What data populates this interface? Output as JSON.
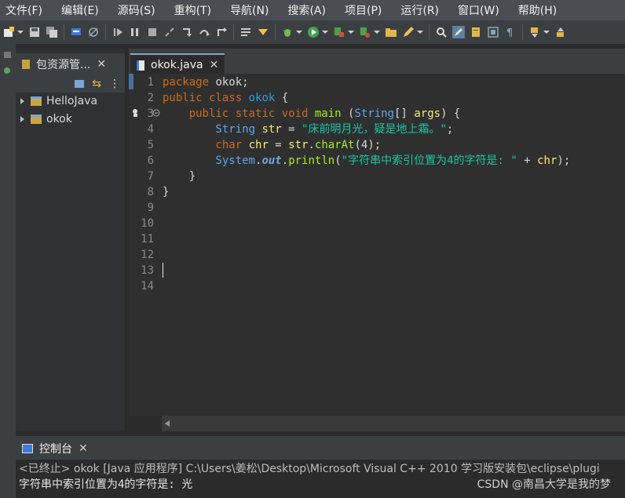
{
  "menu": [
    "文件(F)",
    "编辑(E)",
    "源码(S)",
    "重构(T)",
    "导航(N)",
    "搜索(A)",
    "项目(P)",
    "运行(R)",
    "窗口(W)",
    "帮助(H)"
  ],
  "toolbar_icons": [
    "new-icon",
    "save-icon",
    "save-all-icon",
    "open-type-icon",
    "skip-breakpoints-icon",
    "resume-icon",
    "suspend-icon",
    "terminate-icon",
    "disconnect-icon",
    "step-into-icon",
    "step-over-icon",
    "step-return-icon",
    "use-step-filters-icon",
    "debug-icon",
    "run-icon",
    "coverage-icon",
    "external-tools-icon",
    "open-folder-icon",
    "pencil-icon",
    "search-icon",
    "highlight-icon",
    "annotation-icon",
    "show-whitespace-icon",
    "pilcrow-icon",
    "next-annotation-icon"
  ],
  "explorer": {
    "title": "包资源管...",
    "projects": [
      {
        "name": "HelloJava"
      },
      {
        "name": "okok"
      }
    ]
  },
  "editor": {
    "tab_title": "okok.java",
    "line_numbers": [
      "1",
      "2",
      "3",
      "4",
      "5",
      "6",
      "7",
      "8",
      "9",
      "10",
      "11",
      "12",
      "13",
      "14"
    ],
    "lines": [
      {
        "t1": "package",
        "t2": " okok;"
      },
      {
        "t1": "public",
        "t2": " class ",
        "t3": "okok",
        "t4": " {"
      },
      {
        "t1": "    public",
        "t2": " static ",
        "t3": "void",
        "t4": " main",
        "t5": " (",
        "t6": "String",
        "t7": "[] ",
        "t8": "args",
        "t9": ") {"
      },
      {
        "t1": "        String",
        "t2": " str",
        "t3": " = ",
        "t4": "\"床前明月光，疑是地上霜。\"",
        "t5": ";"
      },
      {
        "t1": "        char",
        "t2": " chr",
        "t3": " = ",
        "t4": "str",
        "t5": ".",
        "t6": "charAt",
        "t7": "(4);"
      },
      {
        "t1": "        System",
        "t2": ".",
        "t3": "out",
        "t4": ".",
        "t5": "println",
        "t6": "(",
        "t7": "\"字符串中索引位置为4的字符是: \"",
        "t8": " + ",
        "t9": "chr",
        "t10": ");"
      },
      {
        "t1": "    }"
      },
      {
        "t1": "}"
      }
    ]
  },
  "console": {
    "title": "控制台",
    "status": "<已终止> okok [Java 应用程序] C:\\Users\\姜松\\Desktop\\Microsoft Visual C++ 2010 学习版安装包\\eclipse\\plugi",
    "output": "字符串中索引位置为4的字符是: 光",
    "watermark": "CSDN @南昌大学是我的梦"
  }
}
